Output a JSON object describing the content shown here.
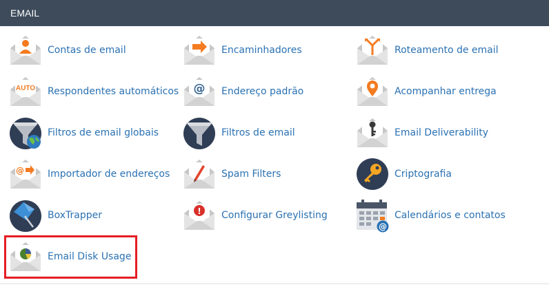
{
  "section": {
    "title": "EMAIL"
  },
  "items": [
    {
      "label": "Contas de email",
      "icon": "email-accounts-icon"
    },
    {
      "label": "Encaminhadores",
      "icon": "forwarders-icon"
    },
    {
      "label": "Roteamento de email",
      "icon": "email-routing-icon"
    },
    {
      "label": "Respondentes automáticos",
      "icon": "autoresponders-icon",
      "badge": "AUTO"
    },
    {
      "label": "Endereço padrão",
      "icon": "default-address-icon",
      "badge": "@"
    },
    {
      "label": "Acompanhar entrega",
      "icon": "track-delivery-icon"
    },
    {
      "label": "Filtros de email globais",
      "icon": "global-email-filters-icon"
    },
    {
      "label": "Filtros de email",
      "icon": "email-filters-icon"
    },
    {
      "label": "Email Deliverability",
      "icon": "email-deliverability-icon"
    },
    {
      "label": "Importador de endereços",
      "icon": "address-importer-icon",
      "badge": "@"
    },
    {
      "label": "Spam Filters",
      "icon": "spam-filters-icon"
    },
    {
      "label": "Criptografia",
      "icon": "encryption-icon"
    },
    {
      "label": "BoxTrapper",
      "icon": "boxtrapper-icon"
    },
    {
      "label": "Configurar Greylisting",
      "icon": "greylisting-icon",
      "badge": "!"
    },
    {
      "label": "Calendários e contatos",
      "icon": "calendars-contacts-icon",
      "badge": "@"
    },
    {
      "label": "Email Disk Usage",
      "icon": "email-disk-usage-icon"
    }
  ],
  "colors": {
    "header_bg": "#3d4b5b",
    "link": "#2a71b2",
    "accent_orange": "#f47b20",
    "highlight": "#e51c23"
  }
}
